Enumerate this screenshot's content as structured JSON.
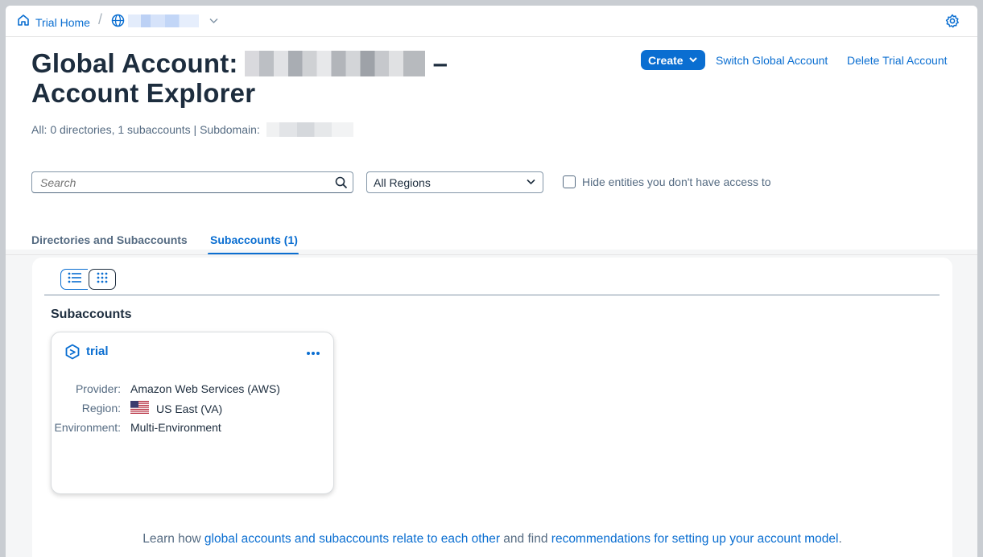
{
  "shellbar": {
    "home_label": "Trial Home",
    "separator": "/"
  },
  "header": {
    "title_prefix": "Global Account:",
    "title_dash": "–",
    "title_line2": "Account Explorer",
    "summary": "All: 0 directories, 1 subaccounts | Subdomain:",
    "actions": {
      "create_label": "Create",
      "switch_label": "Switch Global Account",
      "delete_label": "Delete Trial Account"
    }
  },
  "filters": {
    "search_placeholder": "Search",
    "region_selected": "All Regions",
    "hide_label": "Hide entities you don't have access to"
  },
  "tabs": [
    {
      "label": "Directories and Subaccounts"
    },
    {
      "label": "Subaccounts (1)"
    }
  ],
  "panel": {
    "section_title": "Subaccounts",
    "card": {
      "name": "trial",
      "rows": [
        {
          "label": "Provider:",
          "value": "Amazon Web Services (AWS)"
        },
        {
          "label": "Region:",
          "value": "US East (VA)"
        },
        {
          "label": "Environment:",
          "value": "Multi-Environment"
        }
      ]
    },
    "footer": {
      "t1": "Learn how ",
      "link1": "global accounts and subaccounts relate to each other",
      "t2": " and find ",
      "link2": "recommendations for setting up your account model",
      "t3": "."
    }
  },
  "colors": {
    "accent": "#0a6ed1",
    "text": "#1d2d3e",
    "muted": "#556b82"
  }
}
